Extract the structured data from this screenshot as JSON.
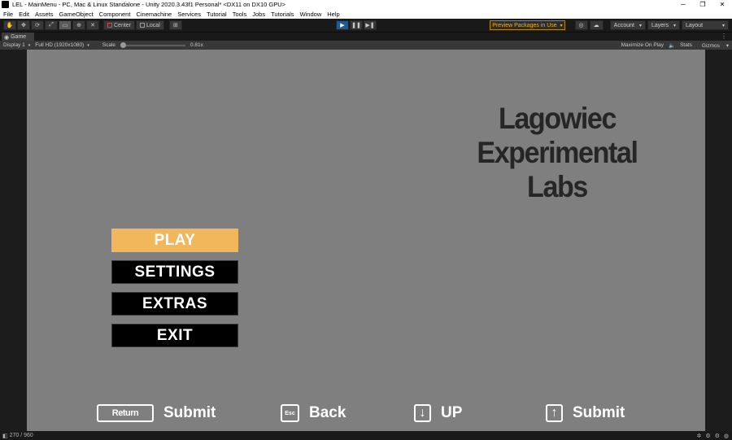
{
  "window": {
    "title": "LEL - MainMenu - PC, Mac & Linux Standalone - Unity 2020.3.43f1 Personal* <DX11 on DX10 GPU>",
    "minimize": "─",
    "maximize": "❐",
    "close": "✕"
  },
  "menu": [
    "File",
    "Edit",
    "Assets",
    "GameObject",
    "Component",
    "Cinemachine",
    "Services",
    "Tutorial",
    "Tools",
    "Jobs",
    "Tutorials",
    "Window",
    "Help"
  ],
  "toolbar": {
    "tools": [
      {
        "icon": "hand-tool-icon",
        "glyph": "✋"
      },
      {
        "icon": "move-tool-icon",
        "glyph": "✥"
      },
      {
        "icon": "rotate-tool-icon",
        "glyph": "⟳"
      },
      {
        "icon": "scale-tool-icon",
        "glyph": "⤢"
      },
      {
        "icon": "rect-tool-icon",
        "glyph": "▭"
      },
      {
        "icon": "transform-tool-icon",
        "glyph": "⊕"
      },
      {
        "icon": "custom-tool-icon",
        "glyph": "✕"
      }
    ],
    "pivot": "Center",
    "space": "Local",
    "snap_glyph": "⊞",
    "play_glyph": "▶",
    "pause_glyph": "❚❚",
    "step_glyph": "▶❚",
    "preview_packages": "Preview Packages in Use",
    "cloud_glyph": "☁",
    "collab_glyph": "◎",
    "account": "Account",
    "layers": "Layers",
    "layout": "Layout",
    "dropdown_glyph": "▾"
  },
  "game_tab": {
    "label": "Game",
    "glyph": "◉",
    "kebab": "⋮"
  },
  "game_bar": {
    "display": "Display 1",
    "resolution": "Full HD (1920x1080)",
    "scale_label": "Scale",
    "scale_value": "0.81x",
    "scale_level": 0.0,
    "maximize": "Maximize On Play",
    "audio_glyph": "🔈",
    "stats": "Stats",
    "gizmos": "Gizmos",
    "arrow": "▾"
  },
  "game": {
    "title_lines": [
      "Lagowiec",
      "Experimental",
      "Labs"
    ],
    "buttons": [
      {
        "label": "PLAY",
        "selected": true
      },
      {
        "label": "SETTINGS",
        "selected": false
      },
      {
        "label": "EXTRAS",
        "selected": false
      },
      {
        "label": "EXIT",
        "selected": false
      }
    ],
    "hints": [
      {
        "key": "Return",
        "label": "Submit"
      },
      {
        "key": "Esc",
        "label": "Back"
      },
      {
        "key": "↓",
        "label": "UP"
      },
      {
        "key": "↑",
        "label": "Submit"
      }
    ],
    "colors": {
      "selected": "#f2b65b",
      "button": "#000000",
      "background": "#7f7f7f"
    }
  },
  "status": {
    "text": "270 / 960",
    "glyph": "⚙"
  }
}
